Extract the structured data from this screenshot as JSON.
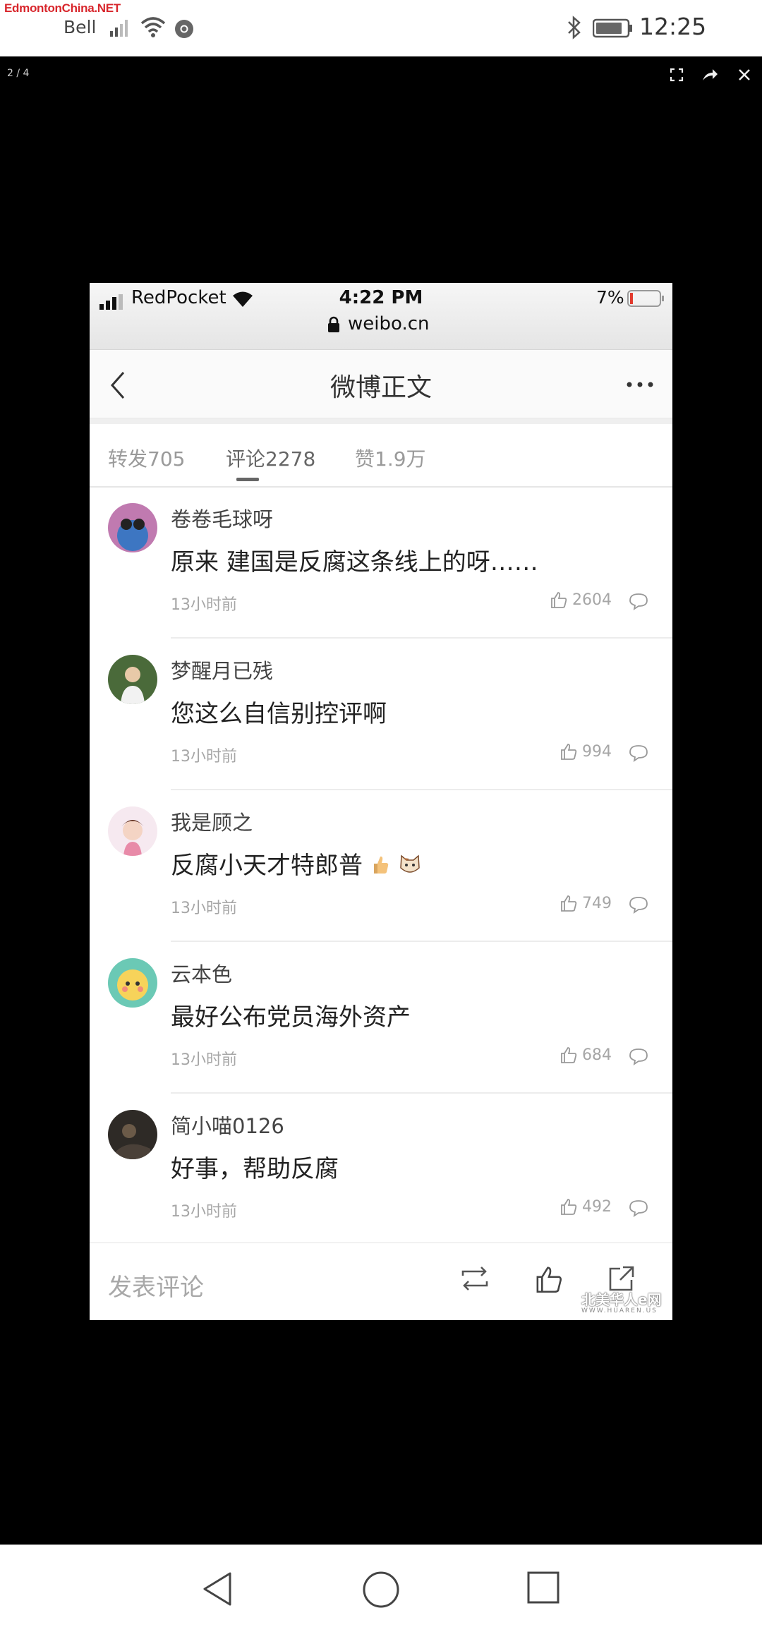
{
  "status_bar": {
    "watermark": "EdmontonChina.NET",
    "carrier": "Bell",
    "time": "12:25"
  },
  "viewer": {
    "counter": "2 / 4"
  },
  "inner_screenshot": {
    "status_bar": {
      "carrier": "RedPocket",
      "time": "4:22 PM",
      "battery": "7%",
      "url": "weibo.cn"
    },
    "header": {
      "title": "微博正文"
    },
    "tabs": [
      {
        "label": "转发705"
      },
      {
        "label": "评论2278"
      },
      {
        "label": "赞1.9万"
      }
    ],
    "comments": [
      {
        "user": "卷卷毛球呀",
        "text": "原来 建国是反腐这条线上的呀……",
        "time": "13小时前",
        "likes": "2604"
      },
      {
        "user": "梦醒月已残",
        "text": "您这么自信别控评啊",
        "time": "13小时前",
        "likes": "994"
      },
      {
        "user": "我是顾之",
        "text": "反腐小天才特郎普",
        "time": "13小时前",
        "likes": "749"
      },
      {
        "user": "云本色",
        "text": "最好公布党员海外资产",
        "time": "13小时前",
        "likes": "684"
      },
      {
        "user": "简小喵0126",
        "text": "好事，帮助反腐",
        "time": "13小时前",
        "likes": "492"
      }
    ],
    "bottom_bar": {
      "placeholder": "发表评论",
      "watermark": "北美华人e网"
    }
  },
  "colors": {
    "watermark_red": "#d8262c",
    "tab_active": "#666666",
    "muted": "#a6a6a6"
  }
}
